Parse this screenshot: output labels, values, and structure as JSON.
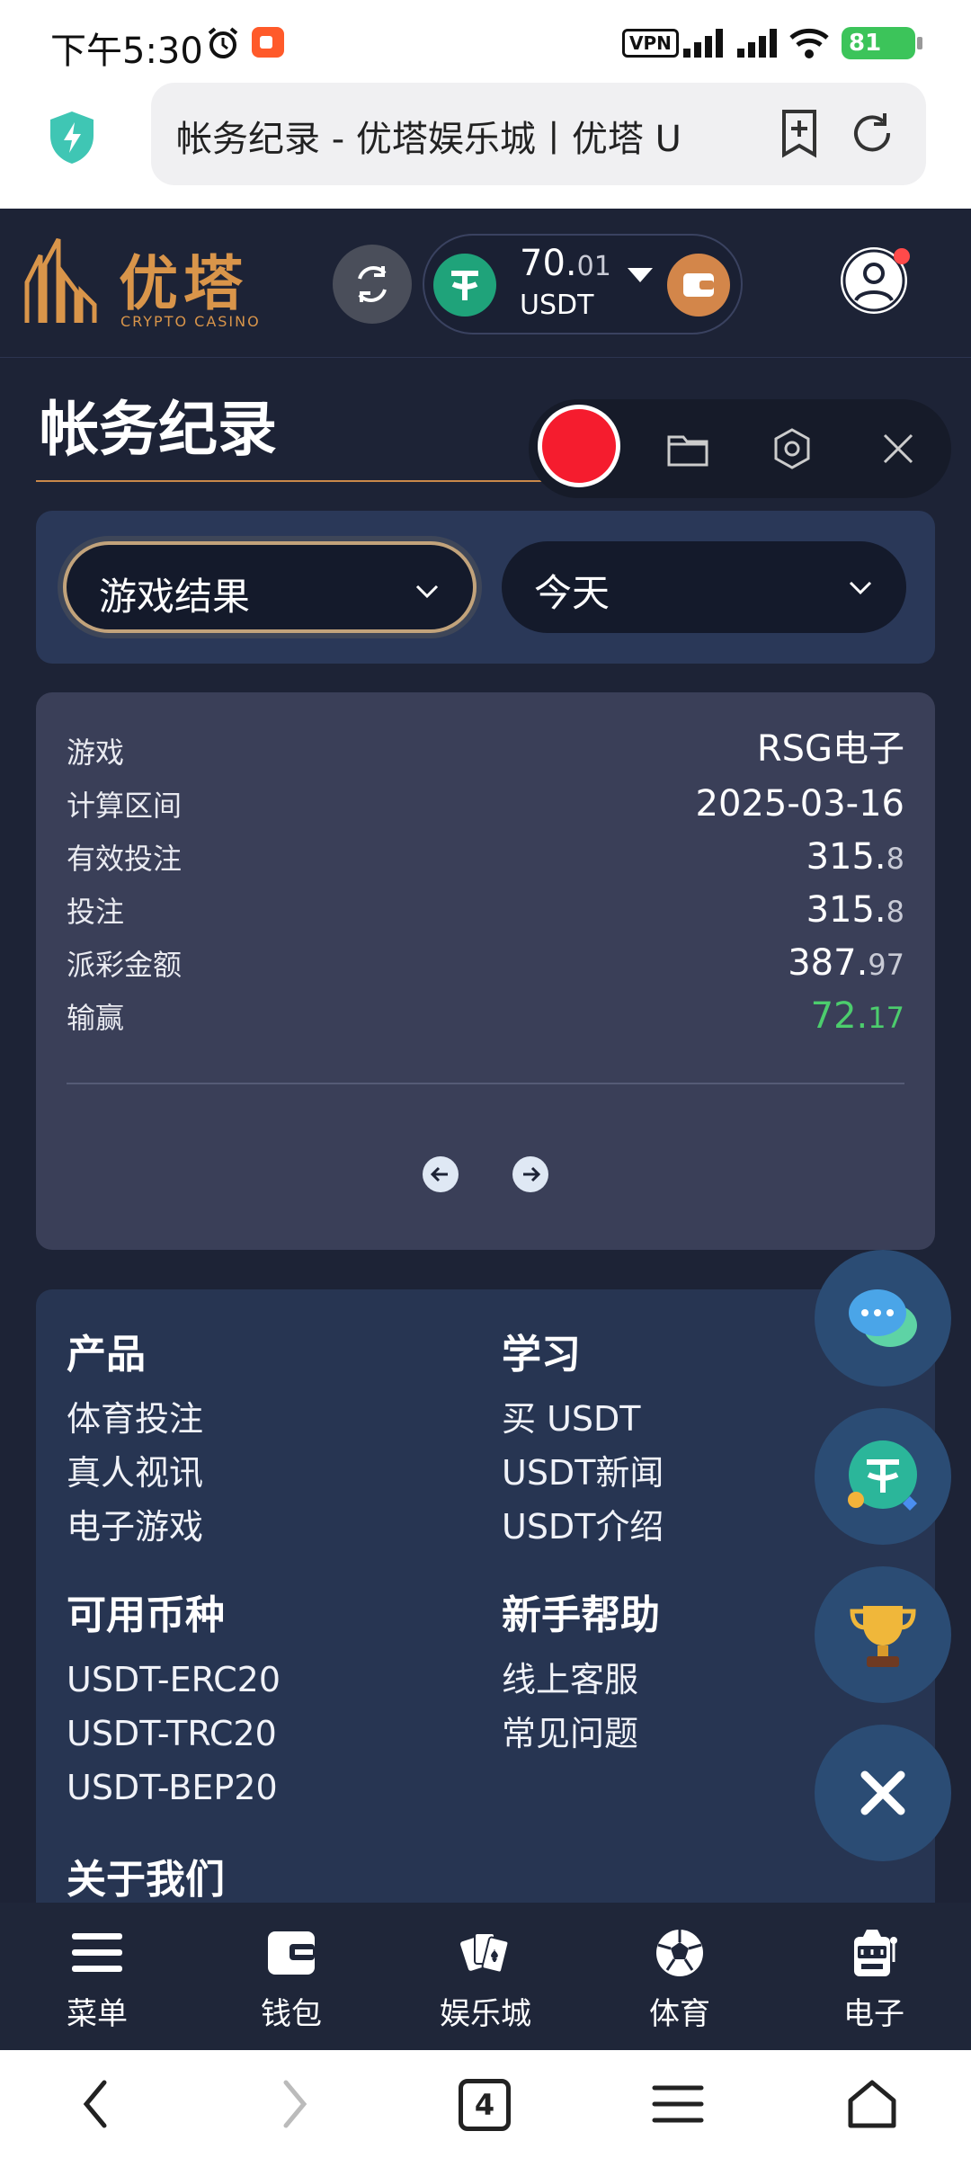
{
  "status_bar": {
    "time": "下午5:30",
    "vpn": "VPN",
    "battery": "81"
  },
  "browser": {
    "url_text": "帐务纪录 - 优塔娱乐城丨优塔 U"
  },
  "site_header": {
    "logo_name": "优塔",
    "logo_sub": "CRYPTO CASINO",
    "balance_int": "70.",
    "balance_dec": "01",
    "currency": "USDT"
  },
  "page": {
    "title": "帐务纪录"
  },
  "filters": {
    "category": "游戏结果",
    "period": "今天"
  },
  "result": {
    "rows": [
      {
        "key": "游戏",
        "val": "RSG电子",
        "dec": ""
      },
      {
        "key": "计算区间",
        "val": "2025-03-16",
        "dec": ""
      },
      {
        "key": "有效投注",
        "val": "315.",
        "dec": "8"
      },
      {
        "key": "投注",
        "val": "315.",
        "dec": "8"
      },
      {
        "key": "派彩金额",
        "val": "387.",
        "dec": "97"
      },
      {
        "key": "输赢",
        "val": "72.",
        "dec": "17"
      }
    ]
  },
  "footer": {
    "products": {
      "title": "产品",
      "items": [
        "体育投注",
        "真人视讯",
        "电子游戏"
      ]
    },
    "learn": {
      "title": "学习",
      "items": [
        "买 USDT",
        "USDT新闻",
        "USDT介绍"
      ]
    },
    "currencies": {
      "title": "可用币种",
      "items": [
        "USDT-ERC20",
        "USDT-TRC20",
        "USDT-BEP20"
      ]
    },
    "help": {
      "title": "新手帮助",
      "items": [
        "线上客服",
        "常见问题"
      ]
    },
    "about": {
      "title": "关于我们"
    }
  },
  "bottom_nav": [
    "菜单",
    "钱包",
    "娱乐城",
    "体育",
    "电子"
  ],
  "system_nav": {
    "tab_count": "4"
  },
  "colors": {
    "background": "#1d2336",
    "accent_gold": "#d9954a",
    "win_green": "#4ccd6d",
    "record_red": "#f51c2e"
  }
}
